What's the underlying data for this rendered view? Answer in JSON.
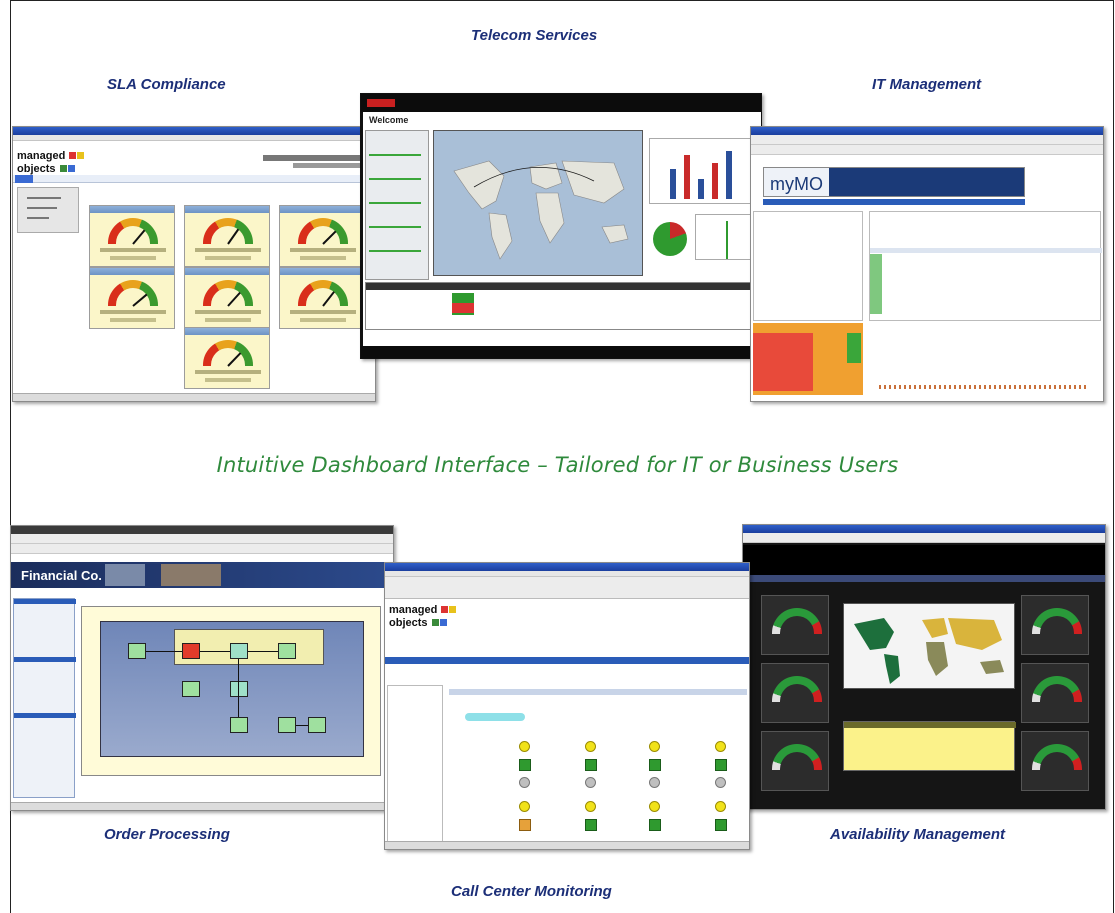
{
  "captions": {
    "telecom": "Telecom Services",
    "sla": "SLA Compliance",
    "it": "IT Management",
    "headline": "Intuitive Dashboard Interface – Tailored for IT or Business Users",
    "order": "Order Processing",
    "availability": "Availability Management",
    "callcenter": "Call Center Monitoring"
  },
  "screens": {
    "telecom": {
      "welcome": "Welcome"
    },
    "it": {
      "brand": "myMO"
    },
    "order": {
      "brand": "Financial Co."
    }
  },
  "colors": {
    "caption": "#1c2f78",
    "headline": "#2f8a3c",
    "gauge_red": "#d92e1a",
    "gauge_amber": "#e8a21c",
    "gauge_green": "#3b9a2e",
    "map_ocean": "#a9bfd7",
    "world_land_dark": "#1d6f3c",
    "world_land_gold": "#d9b43c"
  }
}
